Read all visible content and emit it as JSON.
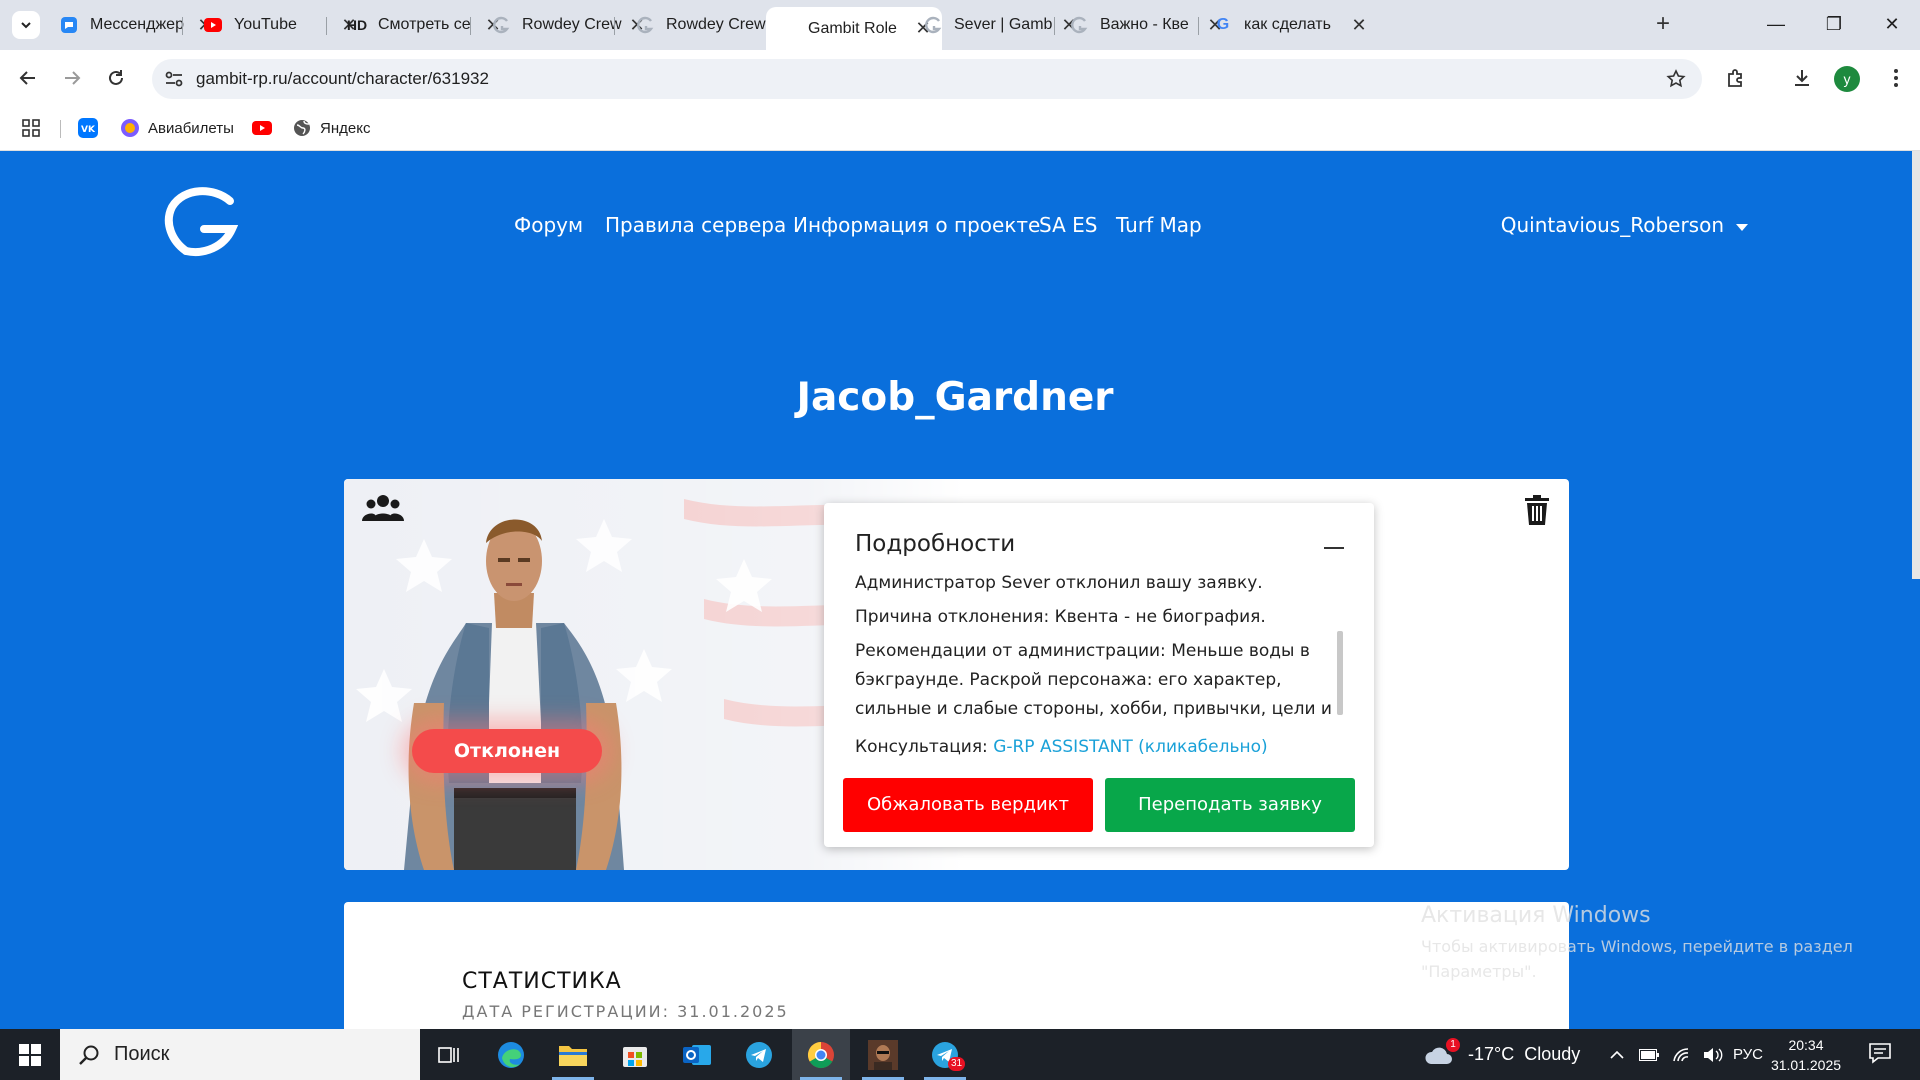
{
  "browser": {
    "tabs": [
      {
        "title": "Мессенджер",
        "icon": "messenger-icon",
        "active": false
      },
      {
        "title": "YouTube",
        "icon": "youtube-icon",
        "active": false
      },
      {
        "title": "Смотреть се",
        "icon": "hd-icon",
        "fav_text": "HD",
        "active": false
      },
      {
        "title": "Rowdey Crew",
        "icon": "gambit-icon",
        "active": false
      },
      {
        "title": "Rowdey Crew",
        "icon": "gambit-icon",
        "active": false
      },
      {
        "title": "Gambit Role",
        "icon": "gambit-icon",
        "active": true
      },
      {
        "title": "Sever | Gamb",
        "icon": "gambit-icon",
        "active": false
      },
      {
        "title": "Важно - Кве",
        "icon": "gambit-icon",
        "active": false
      },
      {
        "title": "как сделать",
        "icon": "google-icon",
        "active": false
      }
    ],
    "new_tab": "+",
    "url": "gambit-rp.ru/account/character/631932",
    "avatar_letter": "y",
    "bookmarks": [
      {
        "label": "",
        "icon": "vk-icon"
      },
      {
        "label": "Авиабилеты",
        "icon": "aviatickets-icon"
      },
      {
        "label": "",
        "icon": "youtube-icon"
      },
      {
        "label": "Яндекс",
        "icon": "globe-icon"
      }
    ]
  },
  "site": {
    "nav": [
      "Форум",
      "Правила сервера",
      "Информация о проекте",
      "SA ES",
      "Turf Map"
    ],
    "user": "Quintavious_Roberson",
    "character_name": "Jacob_Gardner",
    "status": "Отклонен",
    "details": {
      "title": "Подробности",
      "line1": "Администратор Sever отклонил вашу заявку.",
      "line2": "Причина отклонения: Квента - не биография.",
      "line3": "Рекомендации от администрации: Меньше воды в бэкграунде. Раскрой персонажа: его характер, сильные и слабые стороны, хобби, привычки, цели и мечты, взгляды на жизнь.",
      "consult_label": "Консультация: ",
      "consult_link": "G-RP ASSISTANT (кликабельно)",
      "appeal_button": "Обжаловать вердикт",
      "transfer_button": "Переподать заявку"
    },
    "stats": {
      "title": "СТАТИСТИКА",
      "reg_date": "ДАТА РЕГИСТРАЦИИ: 31.01.2025"
    }
  },
  "watermark": {
    "title": "Активация Windows",
    "text": "Чтобы активировать Windows, перейдите в раздел \"Параметры\"."
  },
  "taskbar": {
    "search_placeholder": "Поиск",
    "weather": "-17°C  Cloudy",
    "weather_badge": "1",
    "telegram_badge": "31",
    "language": "РУС",
    "time": "20:34",
    "date": "31.01.2025"
  },
  "colors": {
    "page_bg": "#0a6fdc",
    "status_rejected": "#f44b4b",
    "appeal": "#ff0000",
    "transfer": "#08a74a",
    "link": "#1aa1d8"
  }
}
